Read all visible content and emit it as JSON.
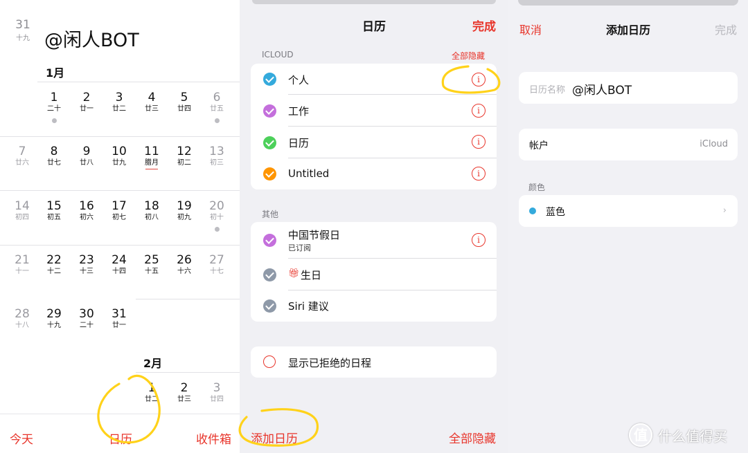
{
  "panel1": {
    "top_date": {
      "day": "31",
      "lunar": "十九"
    },
    "title": "@闲人BOT",
    "month1": "1月",
    "month2": "2月",
    "weeks": [
      [
        [
          "1",
          "二十",
          "n",
          1,
          0
        ],
        [
          "2",
          "廿一",
          "n",
          0,
          0
        ],
        [
          "3",
          "廿二",
          "n",
          0,
          0
        ],
        [
          "4",
          "廿三",
          "n",
          0,
          0
        ],
        [
          "5",
          "廿四",
          "n",
          0,
          0
        ],
        [
          "6",
          "廿五",
          "g",
          1,
          0
        ]
      ],
      [
        [
          "7",
          "廿六",
          "g",
          0,
          0
        ],
        [
          "8",
          "廿七",
          "n",
          0,
          0
        ],
        [
          "9",
          "廿八",
          "n",
          0,
          0
        ],
        [
          "10",
          "廿九",
          "n",
          0,
          0
        ],
        [
          "11",
          "腊月",
          "n",
          0,
          1
        ],
        [
          "12",
          "初二",
          "n",
          0,
          0
        ],
        [
          "13",
          "初三",
          "g",
          0,
          0
        ]
      ],
      [
        [
          "14",
          "初四",
          "g",
          0,
          0
        ],
        [
          "15",
          "初五",
          "n",
          0,
          0
        ],
        [
          "16",
          "初六",
          "n",
          0,
          0
        ],
        [
          "17",
          "初七",
          "n",
          0,
          0
        ],
        [
          "18",
          "初八",
          "n",
          0,
          0
        ],
        [
          "19",
          "初九",
          "n",
          0,
          0
        ],
        [
          "20",
          "初十",
          "g",
          1,
          0
        ]
      ],
      [
        [
          "21",
          "十一",
          "g",
          0,
          0
        ],
        [
          "22",
          "十二",
          "n",
          0,
          0
        ],
        [
          "23",
          "十三",
          "n",
          0,
          0
        ],
        [
          "24",
          "十四",
          "n",
          0,
          0
        ],
        [
          "25",
          "十五",
          "n",
          0,
          0
        ],
        [
          "26",
          "十六",
          "n",
          0,
          0
        ],
        [
          "27",
          "十七",
          "g",
          0,
          0
        ]
      ],
      [
        [
          "28",
          "十八",
          "g",
          0,
          0
        ],
        [
          "29",
          "十九",
          "n",
          0,
          0
        ],
        [
          "30",
          "二十",
          "n",
          0,
          0
        ],
        [
          "31",
          "廿一",
          "n",
          0,
          0
        ]
      ],
      [
        [
          "1",
          "廿二",
          "n",
          0,
          0
        ],
        [
          "2",
          "廿三",
          "n",
          0,
          0
        ],
        [
          "3",
          "廿四",
          "g",
          0,
          0
        ]
      ]
    ],
    "toolbar": {
      "today": "今天",
      "calendars": "日历",
      "inbox": "收件箱"
    }
  },
  "panel2": {
    "title": "日历",
    "done": "完成",
    "icloud_header": "ICLOUD",
    "hide_all_link": "全部隐藏",
    "icloud_items": [
      {
        "label": "个人",
        "color": "#34aadc"
      },
      {
        "label": "工作",
        "color": "#c46fdc"
      },
      {
        "label": "日历",
        "color": "#4cd05a"
      },
      {
        "label": "Untitled",
        "color": "#ff9500"
      }
    ],
    "other_header": "其他",
    "other_items": [
      {
        "label": "中国节假日",
        "sub": "已订阅",
        "color": "#c46fdc"
      },
      {
        "label": "生日",
        "icon": "gift-icon",
        "color": "#8e99a8"
      },
      {
        "label": "Siri 建议",
        "color": "#8e99a8"
      }
    ],
    "show_declined": "显示已拒绝的日程",
    "add_calendar": "添加日历",
    "hide_all_bottom": "全部隐藏",
    "accent": "#e8352b"
  },
  "panel3": {
    "cancel": "取消",
    "title": "添加日历",
    "done": "完成",
    "name_label": "日历名称",
    "name_value": "@闲人BOT",
    "account_label": "帐户",
    "account_value": "iCloud",
    "color_header": "颜色",
    "color_value": "蓝色",
    "color_swatch": "#34aadc"
  },
  "watermark": {
    "logo": "值",
    "text": "什么值得买"
  },
  "annotation_color": "#ffd21a"
}
